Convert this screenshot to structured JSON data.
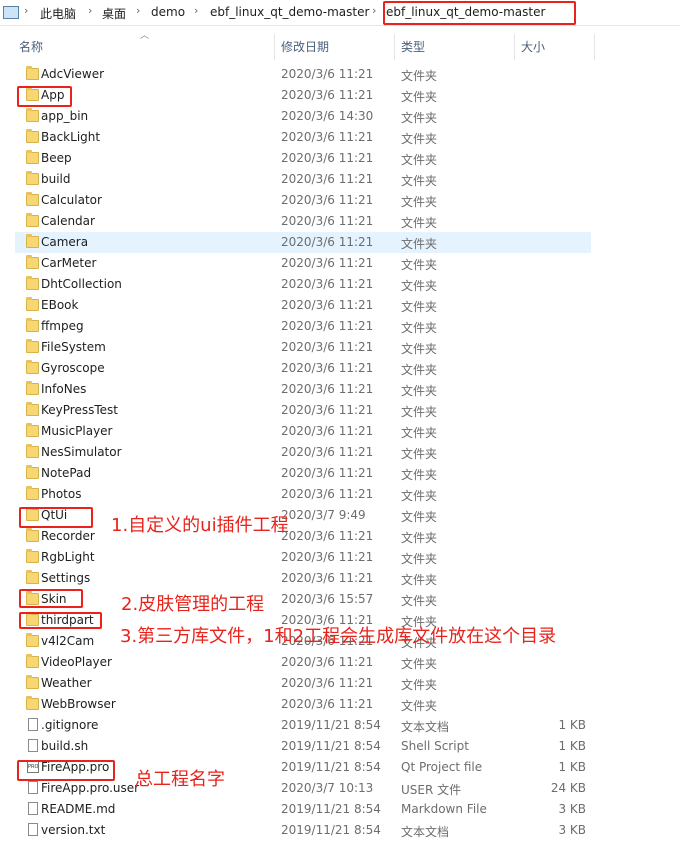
{
  "breadcrumb": [
    "此电脑",
    "桌面",
    "demo",
    "ebf_linux_qt_demo-master",
    "ebf_linux_qt_demo-master"
  ],
  "columns": {
    "name": "名称",
    "date": "修改日期",
    "type": "类型",
    "size": "大小"
  },
  "files": [
    {
      "name": "AdcViewer",
      "date": "2020/3/6 11:21",
      "type": "文件夹",
      "size": "",
      "icon": "folder-icon"
    },
    {
      "name": "App",
      "date": "2020/3/6 11:21",
      "type": "文件夹",
      "size": "",
      "icon": "folder-icon"
    },
    {
      "name": "app_bin",
      "date": "2020/3/6 14:30",
      "type": "文件夹",
      "size": "",
      "icon": "folder-icon"
    },
    {
      "name": "BackLight",
      "date": "2020/3/6 11:21",
      "type": "文件夹",
      "size": "",
      "icon": "folder-icon"
    },
    {
      "name": "Beep",
      "date": "2020/3/6 11:21",
      "type": "文件夹",
      "size": "",
      "icon": "folder-icon"
    },
    {
      "name": "build",
      "date": "2020/3/6 11:21",
      "type": "文件夹",
      "size": "",
      "icon": "folder-icon"
    },
    {
      "name": "Calculator",
      "date": "2020/3/6 11:21",
      "type": "文件夹",
      "size": "",
      "icon": "folder-icon"
    },
    {
      "name": "Calendar",
      "date": "2020/3/6 11:21",
      "type": "文件夹",
      "size": "",
      "icon": "folder-icon"
    },
    {
      "name": "Camera",
      "date": "2020/3/6 11:21",
      "type": "文件夹",
      "size": "",
      "icon": "folder-icon"
    },
    {
      "name": "CarMeter",
      "date": "2020/3/6 11:21",
      "type": "文件夹",
      "size": "",
      "icon": "folder-icon"
    },
    {
      "name": "DhtCollection",
      "date": "2020/3/6 11:21",
      "type": "文件夹",
      "size": "",
      "icon": "folder-icon"
    },
    {
      "name": "EBook",
      "date": "2020/3/6 11:21",
      "type": "文件夹",
      "size": "",
      "icon": "folder-icon"
    },
    {
      "name": "ffmpeg",
      "date": "2020/3/6 11:21",
      "type": "文件夹",
      "size": "",
      "icon": "folder-icon"
    },
    {
      "name": "FileSystem",
      "date": "2020/3/6 11:21",
      "type": "文件夹",
      "size": "",
      "icon": "folder-icon"
    },
    {
      "name": "Gyroscope",
      "date": "2020/3/6 11:21",
      "type": "文件夹",
      "size": "",
      "icon": "folder-icon"
    },
    {
      "name": "InfoNes",
      "date": "2020/3/6 11:21",
      "type": "文件夹",
      "size": "",
      "icon": "folder-icon"
    },
    {
      "name": "KeyPressTest",
      "date": "2020/3/6 11:21",
      "type": "文件夹",
      "size": "",
      "icon": "folder-icon"
    },
    {
      "name": "MusicPlayer",
      "date": "2020/3/6 11:21",
      "type": "文件夹",
      "size": "",
      "icon": "folder-icon"
    },
    {
      "name": "NesSimulator",
      "date": "2020/3/6 11:21",
      "type": "文件夹",
      "size": "",
      "icon": "folder-icon"
    },
    {
      "name": "NotePad",
      "date": "2020/3/6 11:21",
      "type": "文件夹",
      "size": "",
      "icon": "folder-icon"
    },
    {
      "name": "Photos",
      "date": "2020/3/6 11:21",
      "type": "文件夹",
      "size": "",
      "icon": "folder-icon"
    },
    {
      "name": "QtUi",
      "date": "2020/3/7 9:49",
      "type": "文件夹",
      "size": "",
      "icon": "folder-icon"
    },
    {
      "name": "Recorder",
      "date": "2020/3/6 11:21",
      "type": "文件夹",
      "size": "",
      "icon": "folder-icon"
    },
    {
      "name": "RgbLight",
      "date": "2020/3/6 11:21",
      "type": "文件夹",
      "size": "",
      "icon": "folder-icon"
    },
    {
      "name": "Settings",
      "date": "2020/3/6 11:21",
      "type": "文件夹",
      "size": "",
      "icon": "folder-icon"
    },
    {
      "name": "Skin",
      "date": "2020/3/6 15:57",
      "type": "文件夹",
      "size": "",
      "icon": "folder-icon"
    },
    {
      "name": "thirdpart",
      "date": "2020/3/6 11:21",
      "type": "文件夹",
      "size": "",
      "icon": "folder-icon"
    },
    {
      "name": "v4l2Cam",
      "date": "2020/3/6 11:21",
      "type": "文件夹",
      "size": "",
      "icon": "folder-icon"
    },
    {
      "name": "VideoPlayer",
      "date": "2020/3/6 11:21",
      "type": "文件夹",
      "size": "",
      "icon": "folder-icon"
    },
    {
      "name": "Weather",
      "date": "2020/3/6 11:21",
      "type": "文件夹",
      "size": "",
      "icon": "folder-icon"
    },
    {
      "name": "WebBrowser",
      "date": "2020/3/6 11:21",
      "type": "文件夹",
      "size": "",
      "icon": "folder-icon"
    },
    {
      "name": ".gitignore",
      "date": "2019/11/21 8:54",
      "type": "文本文档",
      "size": "1 KB",
      "icon": "text-file-icon"
    },
    {
      "name": "build.sh",
      "date": "2019/11/21 8:54",
      "type": "Shell Script",
      "size": "1 KB",
      "icon": "script-file-icon"
    },
    {
      "name": "FireApp.pro",
      "date": "2019/11/21 8:54",
      "type": "Qt Project file",
      "size": "1 KB",
      "icon": "pro-file-icon"
    },
    {
      "name": "FireApp.pro.user",
      "date": "2020/3/7 10:13",
      "type": "USER 文件",
      "size": "24 KB",
      "icon": "file-icon"
    },
    {
      "name": "README.md",
      "date": "2019/11/21 8:54",
      "type": "Markdown File",
      "size": "3 KB",
      "icon": "markdown-file-icon"
    },
    {
      "name": "version.txt",
      "date": "2019/11/21 8:54",
      "type": "文本文档",
      "size": "3 KB",
      "icon": "text-file-icon"
    }
  ],
  "annotations": {
    "qtui": "1.自定义的ui插件工程",
    "skin": "2.皮肤管理的工程",
    "thirdpart": "3.第三方库文件，1和2工程会生成库文件放在这个目录",
    "fireapp": "总工程名字"
  },
  "colors": {
    "annotation": "#e8231b",
    "selected_row": "#e5f3ff",
    "folder": "#f6d774"
  }
}
